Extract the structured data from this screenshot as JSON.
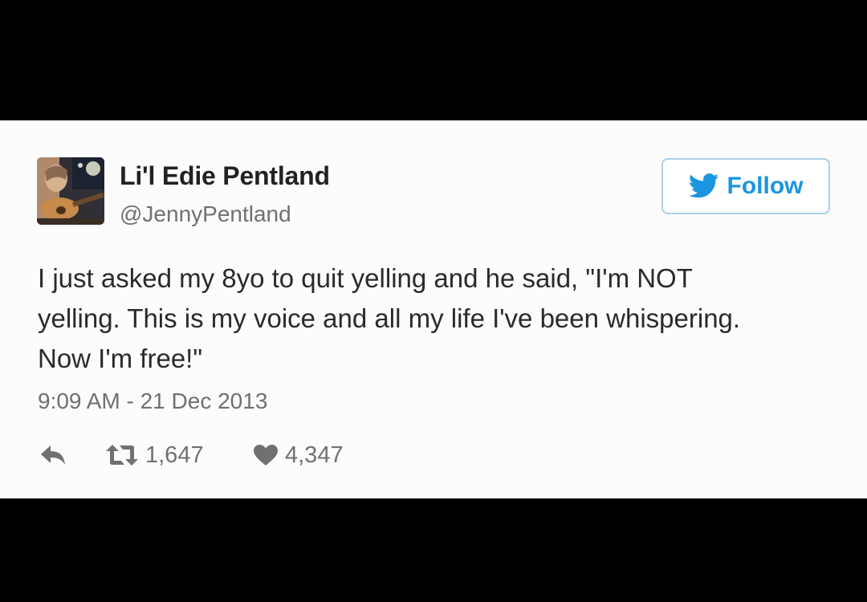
{
  "tweet": {
    "author": {
      "display_name": "Li'l Edie Pentland",
      "handle": "@JennyPentland",
      "avatar_icon": "profile-photo-avatar"
    },
    "follow_button": {
      "label": "Follow",
      "icon": "twitter-bird-icon",
      "color": "#1b95e0"
    },
    "text_lines": [
      "I just asked my 8yo to quit yelling and he said, \"I'm NOT",
      "yelling. This is my voice and all my life I've been whispering.",
      "Now I'm free!\""
    ],
    "timestamp": "9:09 AM - 21 Dec 2013",
    "actions": {
      "reply": {
        "icon": "reply-arrow-icon"
      },
      "retweet": {
        "icon": "retweet-icon",
        "count": "1,647"
      },
      "like": {
        "icon": "heart-icon",
        "count": "4,347"
      }
    }
  },
  "colors": {
    "letterbox": "#000000",
    "card_background": "#fcfcfc",
    "text": "#2a2a2a",
    "muted": "#707070",
    "accent": "#1b95e0"
  }
}
